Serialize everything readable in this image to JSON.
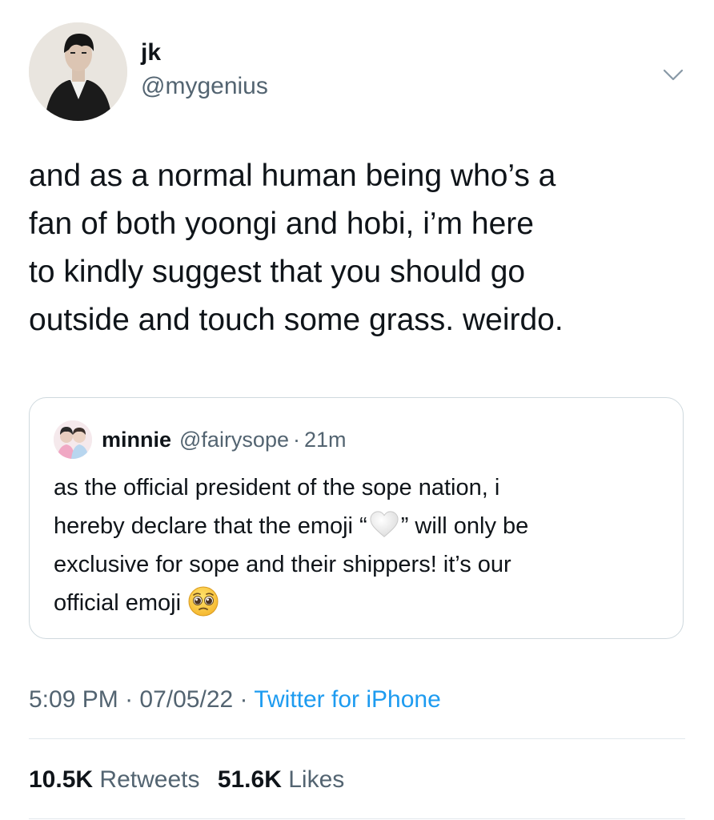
{
  "tweet": {
    "author": {
      "display_name": "jk",
      "handle": "@mygenius",
      "avatar_icon": "profile-photo"
    },
    "menu_icon": "chevron-down-icon",
    "text_lines": [
      "and as a normal human being who’s a",
      "fan of both yoongi and hobi, i’m here",
      "to kindly suggest that you should go",
      "outside and touch some grass. weirdo."
    ],
    "quoted": {
      "display_name": "minnie",
      "handle": "@fairysope",
      "separator": "·",
      "time": "21m",
      "line1": "as the official president of the sope nation, i",
      "line2_before": "hereby declare that the emoji “",
      "line2_emoji": "white-heart-emoji",
      "line2_after": "” will only be",
      "line3": "exclusive for sope and their shippers! it’s our",
      "line4": "official emoji",
      "line4_emoji": "pleading-face-emoji"
    },
    "meta": {
      "time": "5:09 PM",
      "sep1": " · ",
      "date": "07/05/22",
      "sep2": " · ",
      "source": "Twitter for iPhone"
    },
    "stats": {
      "retweets_count": "10.5K",
      "retweets_label": "Retweets",
      "likes_count": "51.6K",
      "likes_label": "Likes"
    }
  },
  "colors": {
    "text": "#0f1419",
    "secondary": "#536471",
    "link": "#1d9bf0",
    "border": "#cfd9de"
  }
}
